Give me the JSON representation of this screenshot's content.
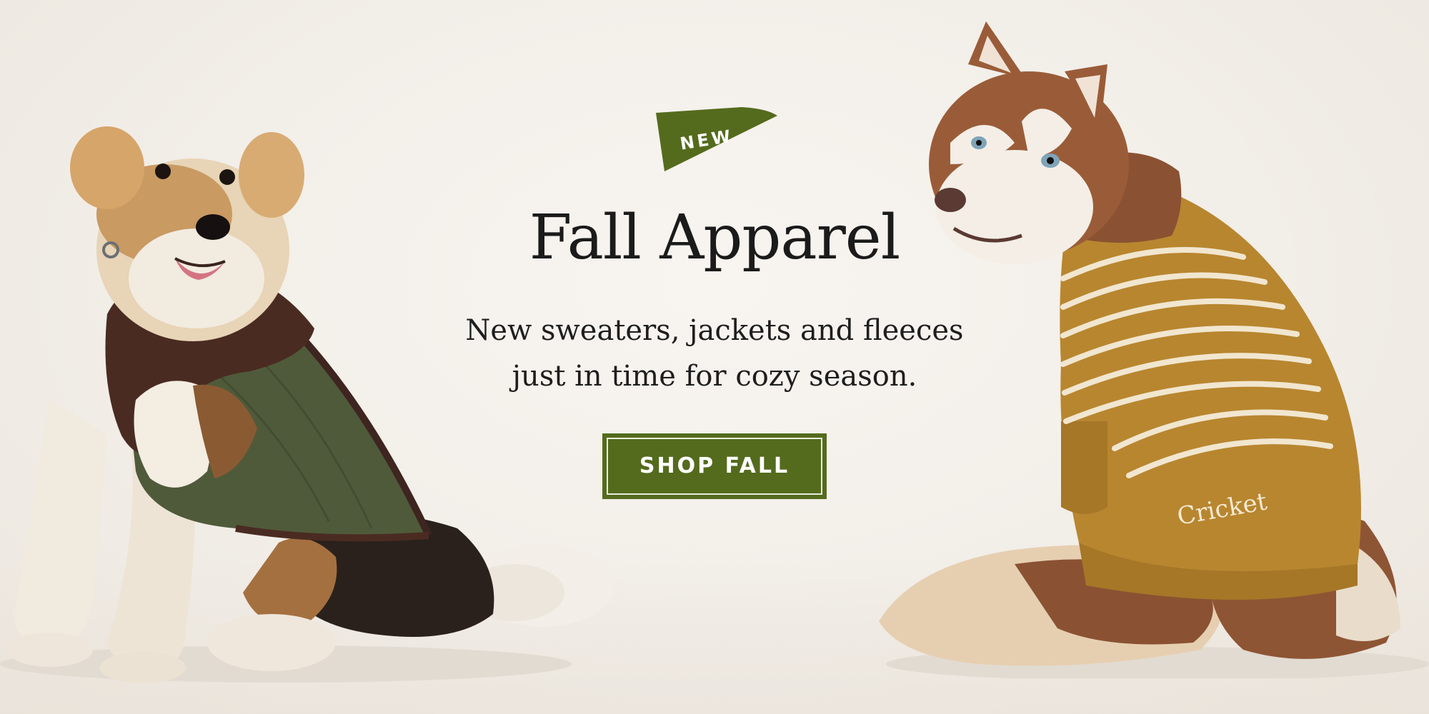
{
  "banner": {
    "badge": {
      "label": "NEW",
      "color": "#546b1d"
    },
    "headline": "Fall Apparel",
    "subcopy": {
      "line1": "New sweaters, jackets and fleeces",
      "line2": "just in time for cozy season."
    },
    "cta": {
      "label": "SHOP FALL",
      "color": "#546b1d"
    },
    "sweater_embroidery": "Cricket"
  },
  "colors": {
    "background": "#f3efe9",
    "brand_green": "#546b1d",
    "text_dark": "#1b1b1b",
    "sweater_mustard": "#b8862f",
    "jacket_olive": "#4f5a3a",
    "jacket_brown": "#4a2b22"
  },
  "imagery": {
    "left": "dog-fox-terrier-in-quilted-jacket",
    "right": "dog-husky-in-striped-sweater"
  }
}
